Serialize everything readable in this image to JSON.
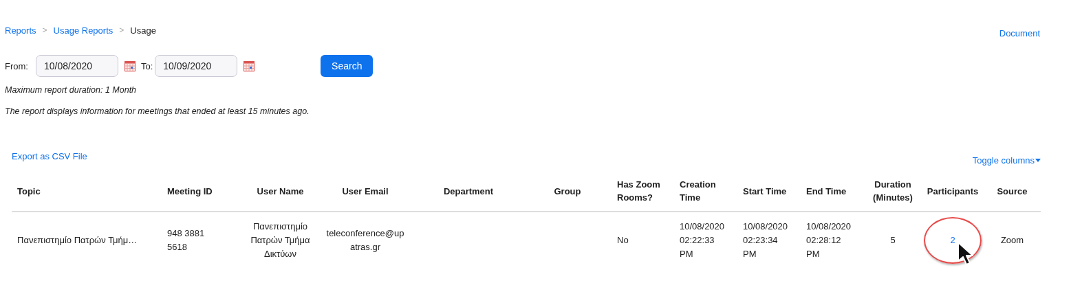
{
  "breadcrumb": [
    {
      "label": "Reports",
      "kind": "link"
    },
    {
      "label": "Usage Reports",
      "kind": "link"
    },
    {
      "label": "Usage",
      "kind": "current"
    }
  ],
  "separator": ">",
  "document_link": "Document",
  "filters": {
    "from_label": "From:",
    "from_value": "10/08/2020",
    "to_label": "To:",
    "to_value": "10/09/2020",
    "search_button": "Search"
  },
  "notes": [
    "Maximum report duration: 1 Month",
    "The report displays information for meetings that ended at least 15 minutes ago."
  ],
  "export_link": "Export as CSV File",
  "toggle_columns": "Toggle columns",
  "table": {
    "columns": [
      "Topic",
      "Meeting ID",
      "User Name",
      "User Email",
      "Department",
      "Group",
      "Has Zoom\nRooms?",
      "Creation\nTime",
      "Start Time",
      "End Time",
      "Duration\n(Minutes)",
      "Participants",
      "Source"
    ],
    "rows": [
      {
        "cells": [
          {
            "text": "Πανεπιστημίο Πατρών Τμήμ…",
            "kind": "text"
          },
          {
            "text": "948 3881\n5618",
            "kind": "text"
          },
          {
            "text": "Πανεπιστημίο\nΠατρών Τμήμα\nΔικτύων",
            "kind": "text"
          },
          {
            "text": "teleconference@up\natras.gr",
            "kind": "text"
          },
          {
            "text": "",
            "kind": "empty"
          },
          {
            "text": "",
            "kind": "empty"
          },
          {
            "text": "No",
            "kind": "text"
          },
          {
            "text": "10/08/2020\n02:22:33\nPM",
            "kind": "text"
          },
          {
            "text": "10/08/2020\n02:23:34\nPM",
            "kind": "text"
          },
          {
            "text": "10/08/2020\n02:28:12\nPM",
            "kind": "text"
          },
          {
            "text": "5",
            "kind": "text"
          },
          {
            "text": "2",
            "kind": "link",
            "highlighted": true
          },
          {
            "text": "Zoom",
            "kind": "text"
          }
        ]
      }
    ]
  }
}
